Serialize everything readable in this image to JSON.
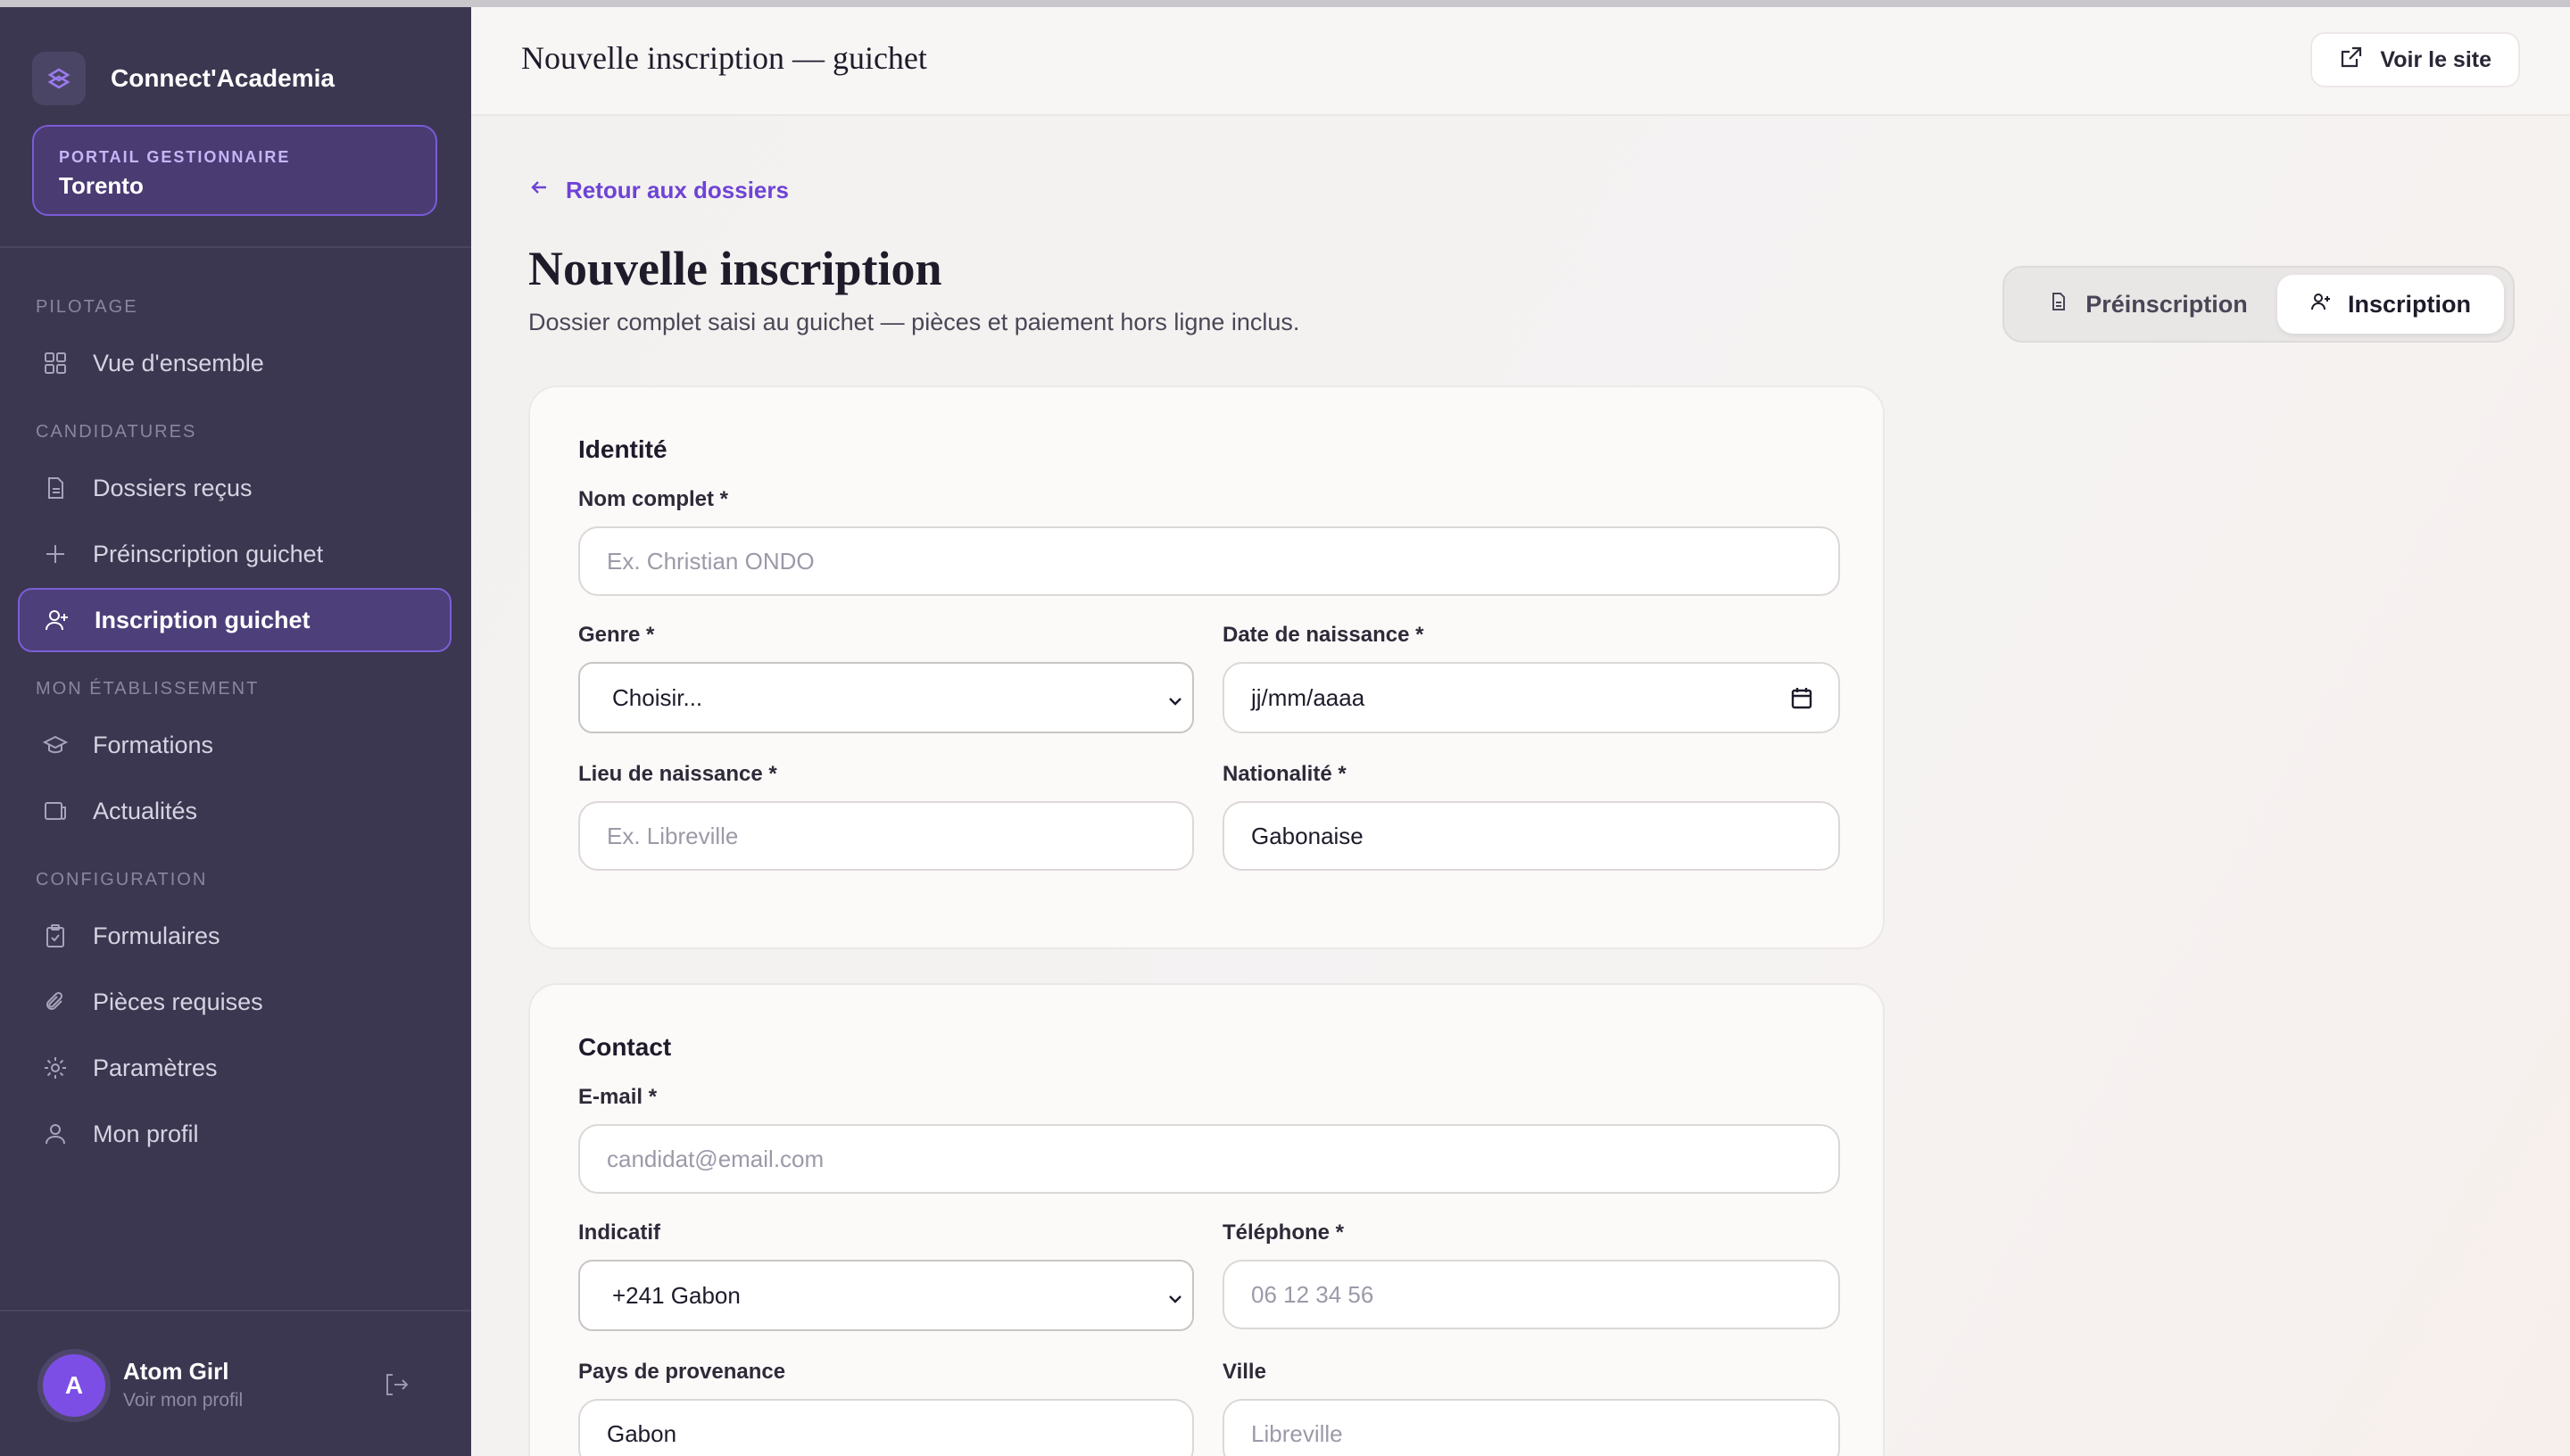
{
  "sidebar": {
    "brand": "Connect'Academia",
    "portal_label": "PORTAIL GESTIONNAIRE",
    "portal_name": "Torento",
    "sections": {
      "pilotage": "PILOTAGE",
      "candidatures": "CANDIDATURES",
      "etablissement": "MON ÉTABLISSEMENT",
      "configuration": "CONFIGURATION"
    },
    "items": {
      "overview": "Vue d'ensemble",
      "dossiers": "Dossiers reçus",
      "preinscription": "Préinscription guichet",
      "inscription": "Inscription guichet",
      "formations": "Formations",
      "actualites": "Actualités",
      "formulaires": "Formulaires",
      "pieces": "Pièces requises",
      "parametres": "Paramètres",
      "profil": "Mon profil"
    },
    "user": {
      "initial": "A",
      "name": "Atom Girl",
      "sub": "Voir mon profil"
    }
  },
  "header": {
    "title": "Nouvelle inscription — guichet",
    "site_button": "Voir le site"
  },
  "page": {
    "back_link": "Retour aux dossiers",
    "title": "Nouvelle inscription",
    "subtitle": "Dossier complet saisi au guichet — pièces et paiement hors ligne inclus.",
    "tabs": {
      "preinscription": "Préinscription",
      "inscription": "Inscription"
    }
  },
  "identite": {
    "title": "Identité",
    "nom_label": "Nom complet *",
    "nom_placeholder": "Ex. Christian ONDO",
    "genre_label": "Genre *",
    "genre_value": "Choisir...",
    "naissance_label": "Date de naissance *",
    "naissance_value": "jj/mm/aaaa",
    "lieu_label": "Lieu de naissance *",
    "lieu_placeholder": "Ex. Libreville",
    "nationalite_label": "Nationalité *",
    "nationalite_value": "Gabonaise"
  },
  "contact": {
    "title": "Contact",
    "email_label": "E-mail *",
    "email_placeholder": "candidat@email.com",
    "indicatif_label": "Indicatif",
    "indicatif_value": "+241 Gabon",
    "telephone_label": "Téléphone *",
    "telephone_placeholder": "06 12 34 56",
    "pays_label": "Pays de provenance",
    "pays_value": "Gabon",
    "ville_label": "Ville",
    "ville_placeholder": "Libreville"
  },
  "colors": {
    "sidebar_bg": "#3b3750",
    "accent": "#6e43d6",
    "active_item_bg": "#4d3f7a"
  }
}
